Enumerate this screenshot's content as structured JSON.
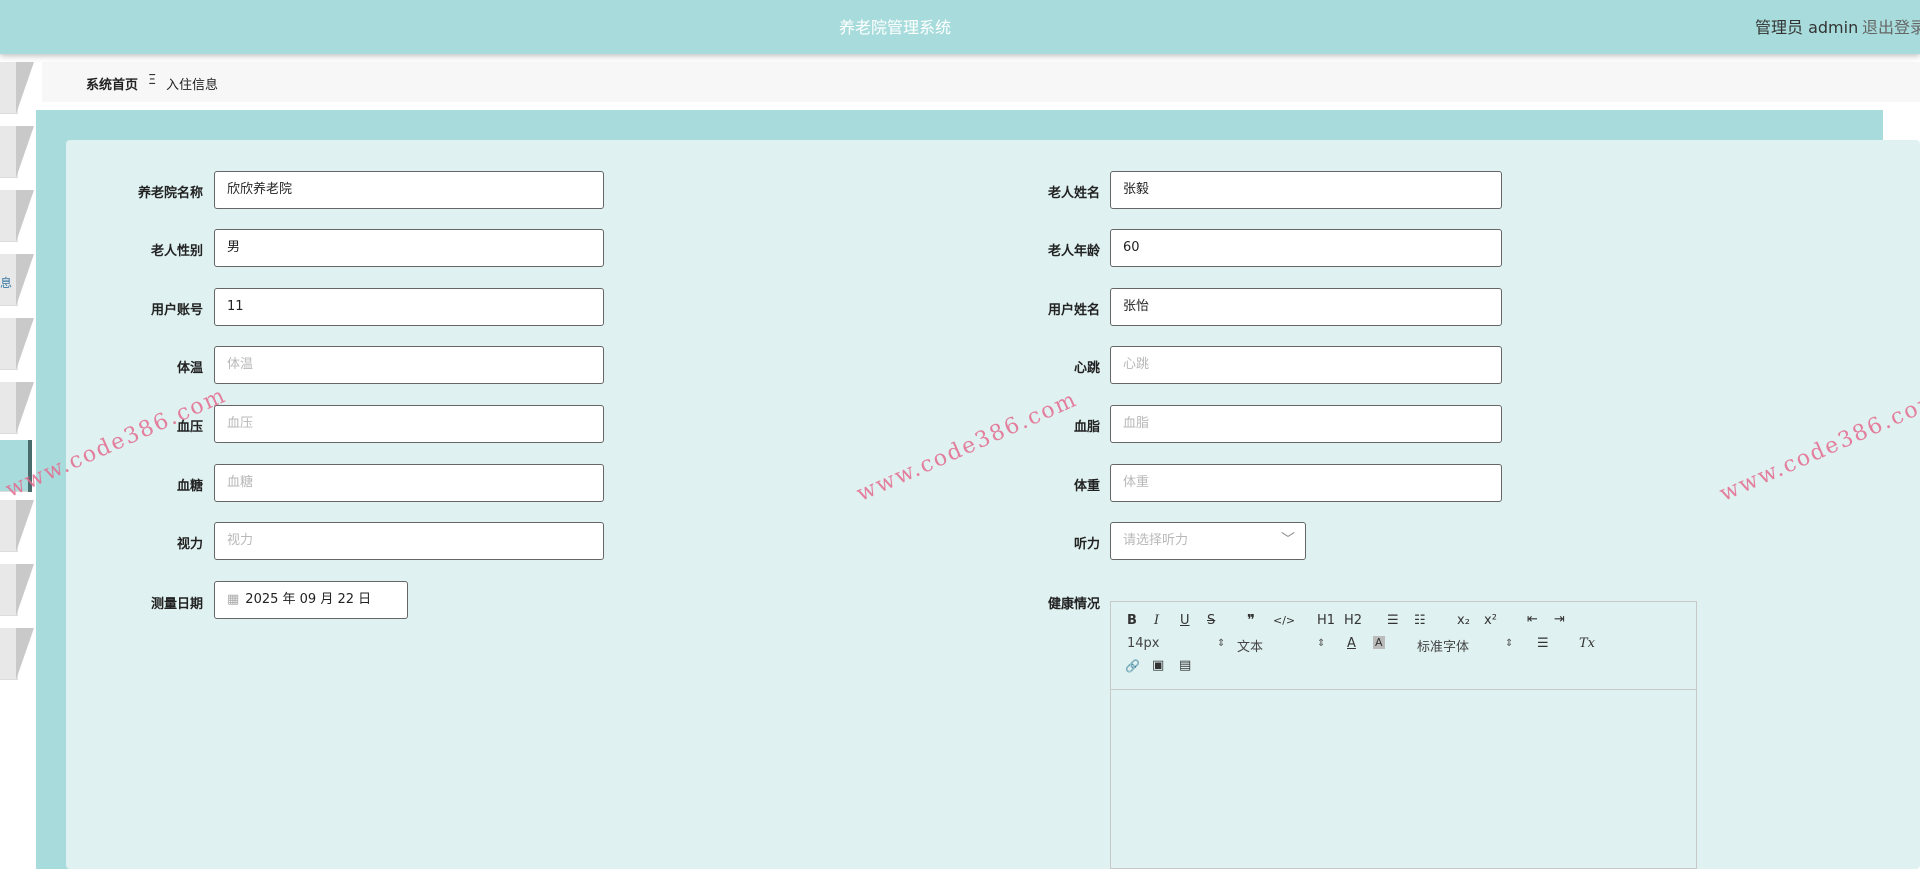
{
  "header": {
    "title": "养老院管理系统",
    "user": "管理员 admin",
    "logout": "退出登录"
  },
  "sidebar": {
    "partial_label": "息"
  },
  "breadcrumb": {
    "home": "系统首页",
    "separator": "Ξ",
    "current": "入住信息"
  },
  "form": {
    "left": [
      {
        "label": "养老院名称",
        "value": "欣欣养老院",
        "placeholder": ""
      },
      {
        "label": "老人性别",
        "value": "男",
        "placeholder": ""
      },
      {
        "label": "用户账号",
        "value": "11",
        "placeholder": ""
      },
      {
        "label": "体温",
        "value": "",
        "placeholder": "体温"
      },
      {
        "label": "血压",
        "value": "",
        "placeholder": "血压"
      },
      {
        "label": "血糖",
        "value": "",
        "placeholder": "血糖"
      },
      {
        "label": "视力",
        "value": "",
        "placeholder": "视力"
      }
    ],
    "right": [
      {
        "label": "老人姓名",
        "value": "张毅",
        "placeholder": ""
      },
      {
        "label": "老人年龄",
        "value": "60",
        "placeholder": ""
      },
      {
        "label": "用户姓名",
        "value": "张怡",
        "placeholder": ""
      },
      {
        "label": "心跳",
        "value": "",
        "placeholder": "心跳"
      },
      {
        "label": "血脂",
        "value": "",
        "placeholder": "血脂"
      },
      {
        "label": "体重",
        "value": "",
        "placeholder": "体重"
      }
    ],
    "date": {
      "label": "测量日期",
      "value": "2025 年 09 月 22 日"
    },
    "hearing": {
      "label": "听力",
      "placeholder": "请选择听力"
    },
    "health": {
      "label": "健康情况"
    }
  },
  "editor": {
    "bold": "B",
    "italic": "I",
    "underline": "U",
    "strike": "S",
    "quote": "❞",
    "code": "</>",
    "h1": "H1",
    "h2": "H2",
    "ordered_list": "☰",
    "bullet_list": "☷",
    "subscript": "x₂",
    "superscript": "x²",
    "outdent": "⇤",
    "indent": "⇥",
    "size": "14px",
    "block": "文本",
    "font_color": "A",
    "bg_color": "A",
    "font": "标准字体",
    "align": "☰",
    "clean": "Tx",
    "link": "🔗",
    "image": "▣",
    "video": "▤"
  },
  "watermark": "www.code386.com"
}
